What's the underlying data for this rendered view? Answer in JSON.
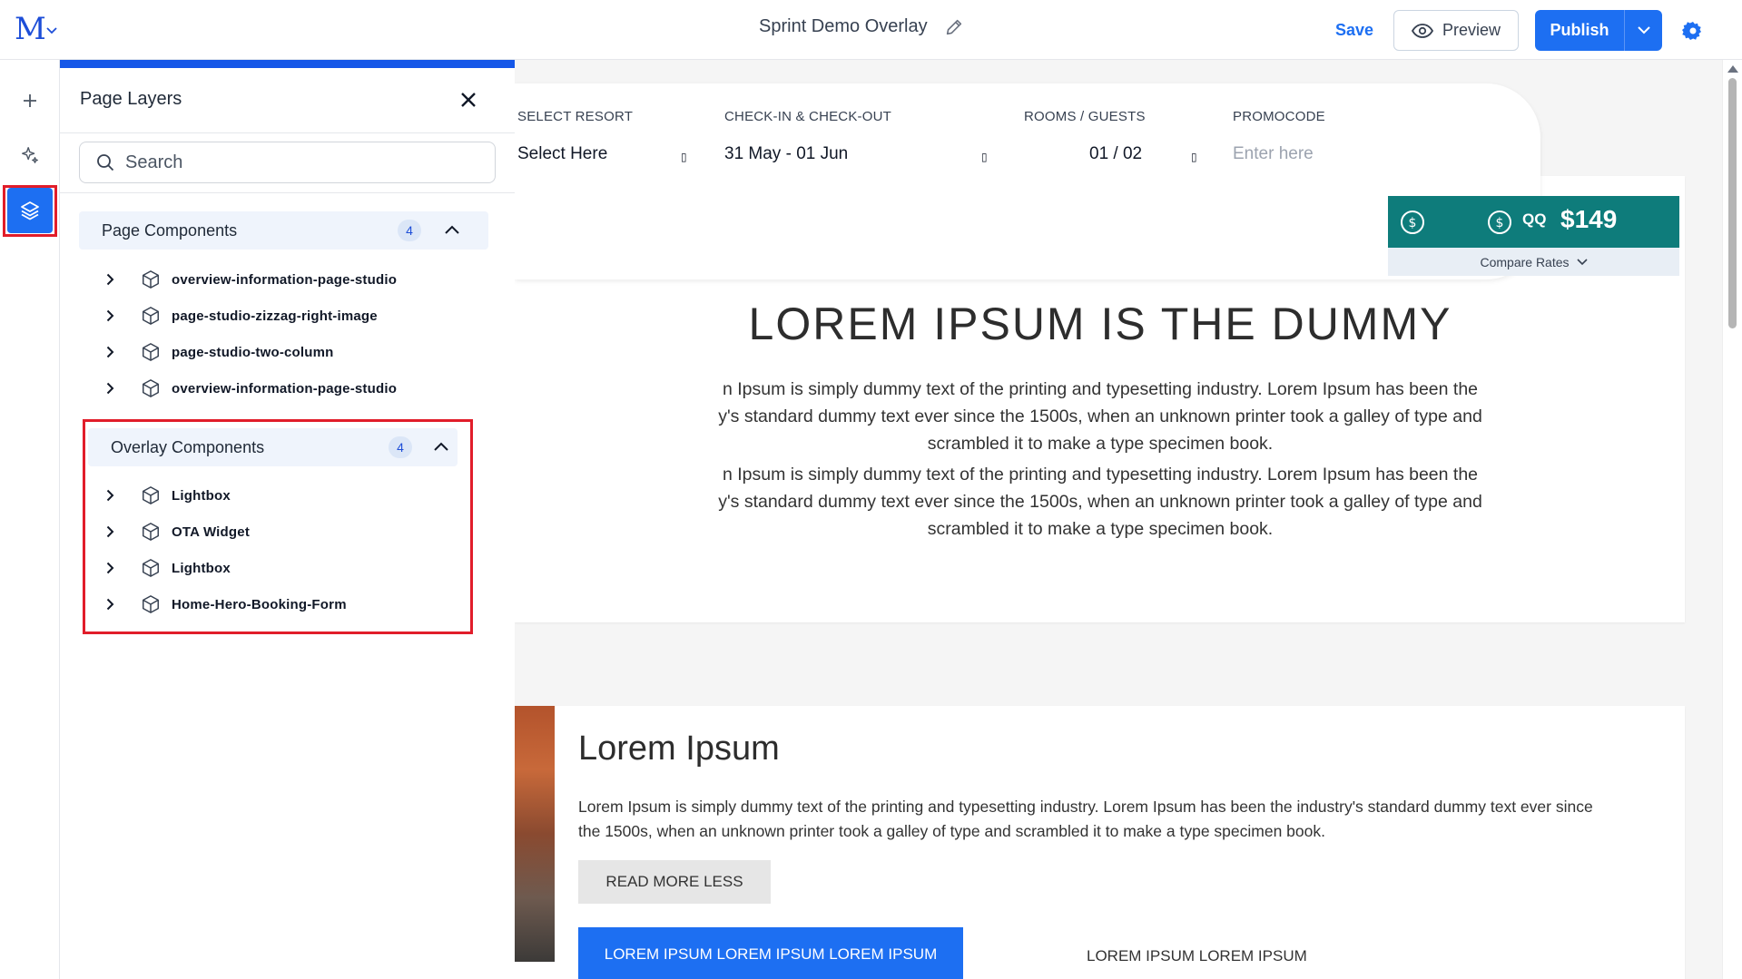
{
  "topbar": {
    "logo_text": "M",
    "doc_title": "Sprint Demo Overlay",
    "save_label": "Save",
    "preview_label": "Preview",
    "publish_label": "Publish"
  },
  "colors": {
    "accent": "#1d6ff2",
    "highlight": "#e11d2a",
    "ota_bg": "#0e7c7b"
  },
  "rail": {
    "icons": [
      "plus-icon",
      "sparkle-icon",
      "layers-icon"
    ],
    "active": "layers-icon"
  },
  "panel": {
    "title": "Page Layers",
    "search_placeholder": "Search",
    "page_components": {
      "label": "Page Components",
      "count": "4",
      "items": [
        "overview-information-page-studio",
        "page-studio-zizzag-right-image",
        "page-studio-two-column",
        "overview-information-page-studio"
      ]
    },
    "overlay_components": {
      "label": "Overlay Components",
      "count": "4",
      "items": [
        "Lightbox",
        "OTA Widget",
        "Lightbox",
        "Home-Hero-Booking-Form"
      ]
    }
  },
  "canvas": {
    "booking": {
      "resort_label": "SELECT RESORT",
      "resort_value": "Select Here",
      "dates_label": "CHECK-IN & CHECK-OUT",
      "dates_value": "31 May - 01 Jun",
      "rooms_label": "ROOMS / GUESTS",
      "rooms_value": "01 / 02",
      "promo_label": "PROMOCODE",
      "promo_placeholder": "Enter here"
    },
    "ota": {
      "name": "QQ",
      "price": "$149",
      "compare_label": "Compare Rates"
    },
    "hero": {
      "title": "LOREM IPSUM IS THE DUMMY",
      "para1_line1": "n Ipsum is simply dummy text of the printing and typesetting industry. Lorem Ipsum has been the",
      "para1_line2": "y's standard dummy text ever since the 1500s, when an unknown printer took a galley of type and",
      "para1_line3": "scrambled it to make a type specimen book.",
      "para2_line1": "n Ipsum is simply dummy text of the printing and typesetting industry. Lorem Ipsum has been the",
      "para2_line2": "y's standard dummy text ever since the 1500s, when an unknown printer took a galley of type and",
      "para2_line3": "scrambled it to make a type specimen book."
    },
    "section2": {
      "title": "Lorem Ipsum",
      "text": "Lorem Ipsum is simply dummy text of the printing and typesetting industry. Lorem Ipsum has been the industry's standard dummy text ever since the 1500s, when an unknown printer took a galley of type and scrambled it to make a type specimen book.",
      "read_more_label": "READ MORE LESS",
      "cta_label": "LOREM IPSUM LOREM IPSUM LOREM IPSUM",
      "cta2_label": "LOREM IPSUM LOREM IPSUM"
    }
  }
}
